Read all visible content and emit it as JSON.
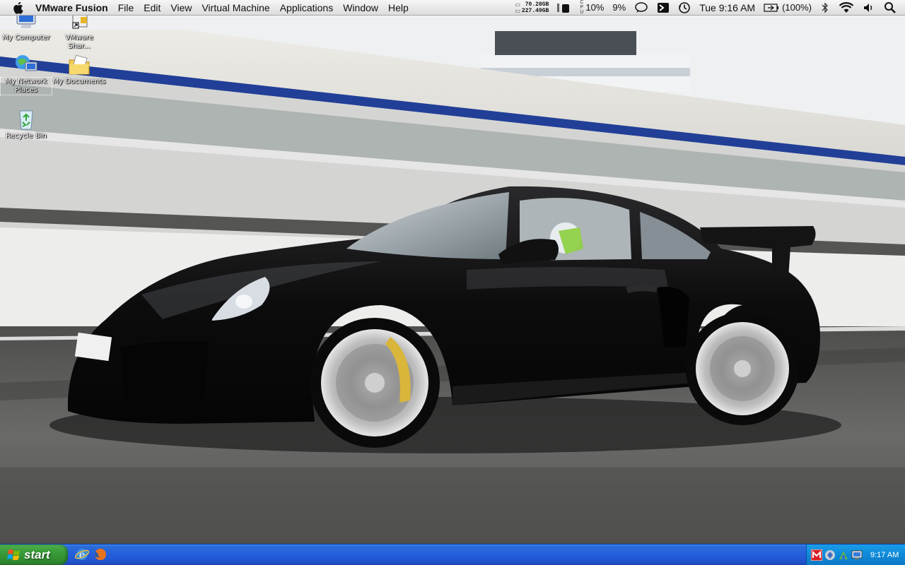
{
  "menubar": {
    "app_name": "VMware Fusion",
    "items": [
      "File",
      "Edit",
      "View",
      "Virtual Machine",
      "Applications",
      "Window",
      "Help"
    ],
    "disk_free_1": "70.28GB",
    "disk_free_2": "227.49GB",
    "cpu_percent": "10%",
    "mem_percent": "9%",
    "clock": "Tue 9:16 AM",
    "battery": "(100%)"
  },
  "desktop": {
    "icons": [
      {
        "label": "My Computer"
      },
      {
        "label": "VMware Shar..."
      },
      {
        "label": "My Network Places"
      },
      {
        "label": "My Documents"
      },
      {
        "label": "Recycle Bin"
      }
    ]
  },
  "taskbar": {
    "start_label": "start",
    "clock": "9:17 AM"
  }
}
